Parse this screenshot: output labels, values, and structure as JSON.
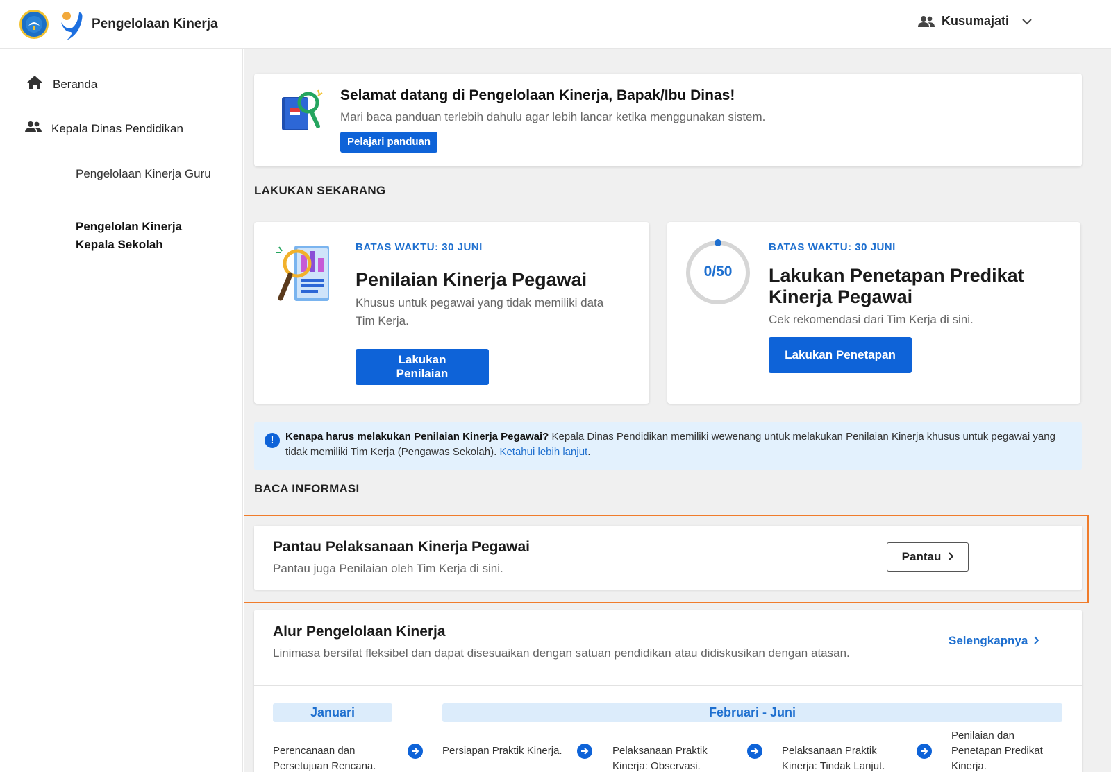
{
  "header": {
    "app_title": "Pengelolaan Kinerja",
    "user_name": "Kusumajati"
  },
  "sidebar": {
    "items": [
      {
        "label": "Beranda",
        "icon": "home-icon"
      },
      {
        "label": "Kepala Dinas Pendidikan",
        "icon": "people-icon"
      }
    ],
    "subitems": [
      {
        "label": "Pengelolaan Kinerja Guru",
        "active": false
      },
      {
        "label": "Pengelolan Kinerja Kepala Sekolah",
        "active": true
      }
    ]
  },
  "welcome": {
    "title": "Selamat datang di Pengelolaan Kinerja, Bapak/Ibu Dinas!",
    "subtitle": "Mari baca panduan terlebih dahulu agar lebih lancar ketika menggunakan sistem.",
    "button": "Pelajari panduan"
  },
  "sections": {
    "do_now": "LAKUKAN SEKARANG",
    "read_info": "BACA INFORMASI"
  },
  "tasks": [
    {
      "deadline": "BATAS WAKTU: 30 JUNI",
      "title": "Penilaian Kinerja Pegawai",
      "desc": "Khusus untuk pegawai yang tidak memiliki data Tim Kerja.",
      "button": "Lakukan Penilaian"
    },
    {
      "deadline": "BATAS WAKTU: 30 JUNI",
      "title": "Lakukan Penetapan Predikat Kinerja Pegawai",
      "desc": "Cek rekomendasi dari Tim Kerja di sini.",
      "button": "Lakukan Penetapan",
      "progress_label": "0/50",
      "progress_value": 0
    }
  ],
  "info": {
    "bold": "Kenapa harus melakukan Penilaian Kinerja Pegawai?",
    "text": " Kepala Dinas Pendidikan memiliki wewenang untuk melakukan Penilaian Kinerja khusus untuk pegawai yang tidak memiliki Tim Kerja (Pengawas Sekolah). ",
    "link": "Ketahui lebih lanjut",
    "end": "."
  },
  "monitor": {
    "title": "Pantau Pelaksanaan Kinerja Pegawai",
    "subtitle": "Pantau juga Penilaian oleh Tim Kerja di sini.",
    "button": "Pantau"
  },
  "flow": {
    "title": "Alur Pengelolaan Kinerja",
    "subtitle": "Linimasa bersifat fleksibel dan dapat disesuaikan dengan satuan pendidikan atau didiskusikan dengan atasan.",
    "more": "Selengkapnya",
    "periods": [
      "Januari",
      "Februari - Juni"
    ],
    "steps": [
      "Perencanaan dan Persetujuan Rencana.",
      "Persiapan Praktik Kinerja.",
      "Pelaksanaan Praktik Kinerja: Observasi.",
      "Pelaksanaan Praktik Kinerja: Tindak Lanjut.",
      "Penilaian dan Penetapan Predikat Kinerja."
    ]
  },
  "colors": {
    "primary": "#0e63d8",
    "link": "#1e6fcf",
    "highlight": "#f07c2b",
    "info_bg": "#e3f1fd"
  }
}
